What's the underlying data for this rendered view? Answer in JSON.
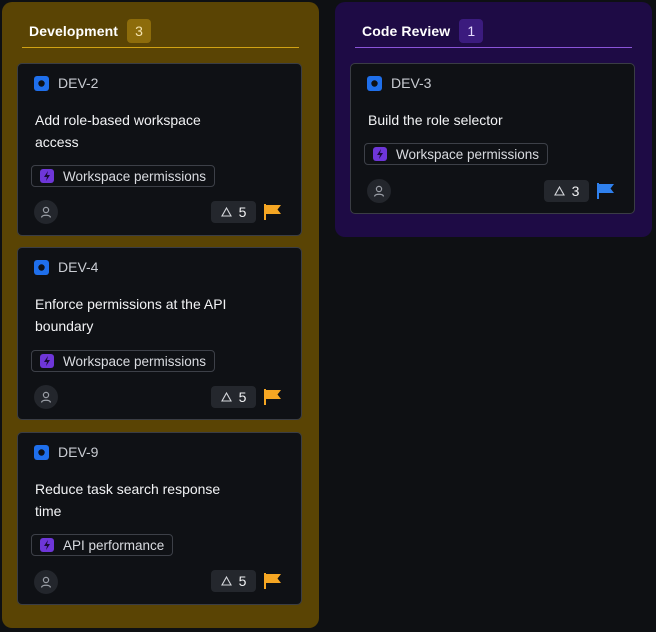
{
  "colors": {
    "development_column": "#5a4404",
    "code_review_column": "#1e0b45",
    "card_background": "#0f1115",
    "type_icon": "#1f6feb",
    "tag_icon": "#6e36d8",
    "priority_high": "#f5a623",
    "priority_normal": "#2f80ed"
  },
  "columns": [
    {
      "title": "Development",
      "count": "3",
      "cards": [
        {
          "id": "DEV-2",
          "title": "Add role-based workspace access",
          "tag": "Workspace permissions",
          "points": "5",
          "type_icon": "task-icon",
          "tag_icon": "lightning-icon",
          "priority_icon": "flag-icon",
          "priority_color": "#f5a623"
        },
        {
          "id": "DEV-4",
          "title": "Enforce permissions at the API boundary",
          "tag": "Workspace permissions",
          "points": "5",
          "type_icon": "task-icon",
          "tag_icon": "lightning-icon",
          "priority_icon": "flag-icon",
          "priority_color": "#f5a623"
        },
        {
          "id": "DEV-9",
          "title": "Reduce task search response time",
          "tag": "API performance",
          "points": "5",
          "type_icon": "task-icon",
          "tag_icon": "lightning-icon",
          "priority_icon": "flag-icon",
          "priority_color": "#f5a623"
        }
      ]
    },
    {
      "title": "Code Review",
      "count": "1",
      "cards": [
        {
          "id": "DEV-3",
          "title": "Build the role selector",
          "tag": "Workspace permissions",
          "points": "3",
          "type_icon": "task-icon",
          "tag_icon": "lightning-icon",
          "priority_icon": "flag-icon",
          "priority_color": "#2f80ed"
        }
      ]
    }
  ]
}
